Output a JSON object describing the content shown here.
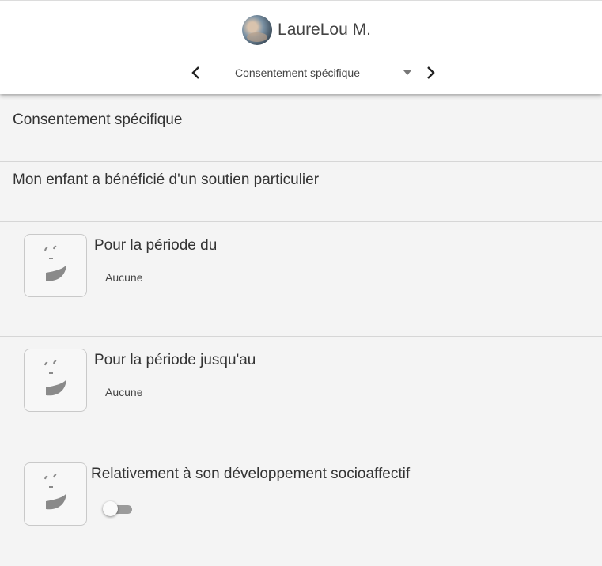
{
  "header": {
    "user_name": "LaureLou M.",
    "nav": {
      "selected_form": "Consentement spécifique"
    }
  },
  "content": {
    "section_title": "Consentement spécifique",
    "subtitle": "Mon enfant a bénéficié d'un soutien particulier",
    "items": [
      {
        "title": "Pour la période du",
        "value": "Aucune",
        "control": "text"
      },
      {
        "title": "Pour la période jusqu'au",
        "value": "Aucune",
        "control": "text"
      },
      {
        "title": "Relativement à son développement socioaffectif",
        "control": "toggle",
        "toggle_on": false
      }
    ]
  },
  "colors": {
    "background": "#f4f4f4",
    "header_background": "#ffffff",
    "toggle_track_off": "#9b9b9b",
    "icon_gray": "#8a8a8a"
  },
  "icons": [
    "avatar",
    "chevron-left-icon",
    "chevron-right-icon",
    "caret-down-icon",
    "smiley-placeholder-icon"
  ]
}
